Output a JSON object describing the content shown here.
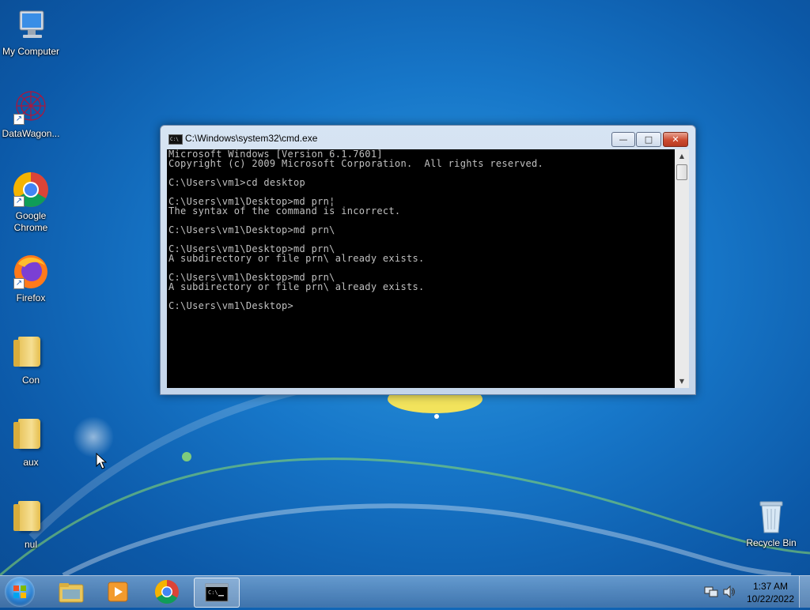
{
  "desktop": {
    "icons": [
      {
        "label": "My Computer"
      },
      {
        "label": "DataWagon..."
      },
      {
        "label": "Google Chrome"
      },
      {
        "label": "Firefox"
      },
      {
        "label": "Con"
      },
      {
        "label": "aux"
      },
      {
        "label": "nul"
      },
      {
        "label": "Recycle Bin"
      }
    ]
  },
  "window": {
    "title": "C:\\Windows\\system32\\cmd.exe",
    "minimize_glyph": "—",
    "maximize_glyph": "□",
    "close_glyph": "✕",
    "console_lines": [
      "Microsoft Windows [Version 6.1.7601]",
      "Copyright (c) 2009 Microsoft Corporation.  All rights reserved.",
      "",
      "C:\\Users\\vm1>cd desktop",
      "",
      "C:\\Users\\vm1\\Desktop>md prn¦",
      "The syntax of the command is incorrect.",
      "",
      "C:\\Users\\vm1\\Desktop>md prn\\",
      "",
      "C:\\Users\\vm1\\Desktop>md prn\\",
      "A subdirectory or file prn\\ already exists.",
      "",
      "C:\\Users\\vm1\\Desktop>md prn\\",
      "A subdirectory or file prn\\ already exists.",
      "",
      "C:\\Users\\vm1\\Desktop>"
    ]
  },
  "taskbar": {
    "pinned": [
      "windows-explorer",
      "media-player",
      "google-chrome",
      "command-prompt"
    ],
    "clock_time": "1:37 AM",
    "clock_date": "10/22/2022"
  },
  "colors": {
    "console_bg": "#000000",
    "console_fg": "#c0c0c0",
    "desktop_blue": "#1777c9"
  }
}
